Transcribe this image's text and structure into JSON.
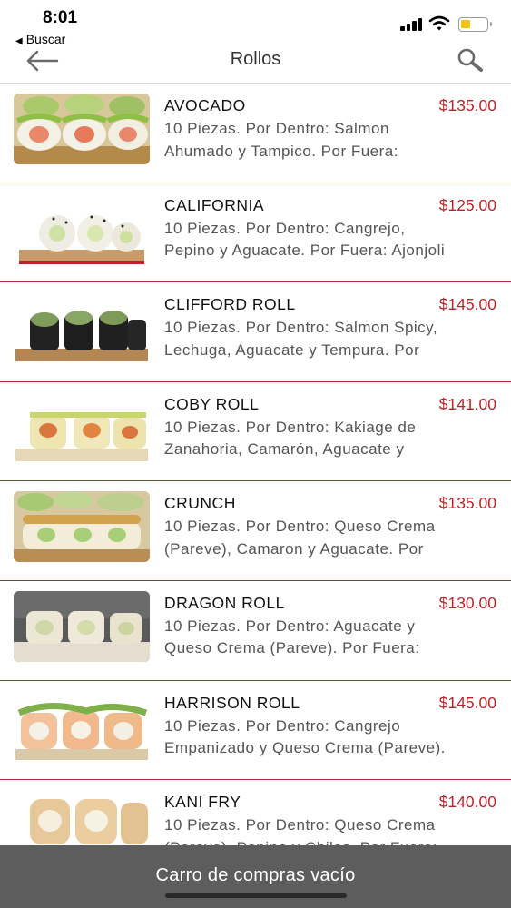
{
  "status_bar": {
    "time": "8:01",
    "back_app": "Buscar",
    "back_icon": "back-triangle-icon"
  },
  "nav": {
    "title": "Rollos",
    "back_icon": "arrow-left-icon",
    "search_icon": "search-icon"
  },
  "colors": {
    "accent": "#b8242a",
    "cart_bar": "#5d5d5d",
    "battery": "#f5c400"
  },
  "items": [
    {
      "name": "AVOCADO",
      "price": "$135.00",
      "line1": "10 Piezas. Por Dentro: Salmon",
      "line2": "Ahumado y Tampico. Por Fuera:"
    },
    {
      "name": "CALIFORNIA",
      "price": "$125.00",
      "line1": "10 Piezas. Por Dentro: Cangrejo,",
      "line2": "Pepino y Aguacate. Por Fuera: Ajonjoli"
    },
    {
      "name": "CLIFFORD ROLL",
      "price": "$145.00",
      "line1": "10 Piezas. Por Dentro: Salmon Spicy,",
      "line2": "Lechuga, Aguacate y Tempura. Por"
    },
    {
      "name": "COBY ROLL",
      "price": "$141.00",
      "line1": "10 Piezas. Por Dentro: Kakiage de",
      "line2": "Zanahoria, Camarón, Aguacate y"
    },
    {
      "name": "CRUNCH",
      "price": "$135.00",
      "line1": "10 Piezas. Por Dentro: Queso Crema",
      "line2": "(Pareve), Camaron y Aguacate. Por"
    },
    {
      "name": "DRAGON ROLL",
      "price": "$130.00",
      "line1": "10 Piezas. Por Dentro: Aguacate y",
      "line2": "Queso Crema (Pareve). Por Fuera:"
    },
    {
      "name": "HARRISON ROLL",
      "price": "$145.00",
      "line1": "10 Piezas. Por Dentro: Cangrejo",
      "line2": "Empanizado y Queso Crema (Pareve)."
    },
    {
      "name": "KANI FRY",
      "price": "$140.00",
      "line1": "10 Piezas. Por Dentro: Queso Crema",
      "line2": "(Pareve), Pepino y Chiles. Por Fuera:"
    }
  ],
  "cart": {
    "label": "Carro de compras vacío"
  }
}
